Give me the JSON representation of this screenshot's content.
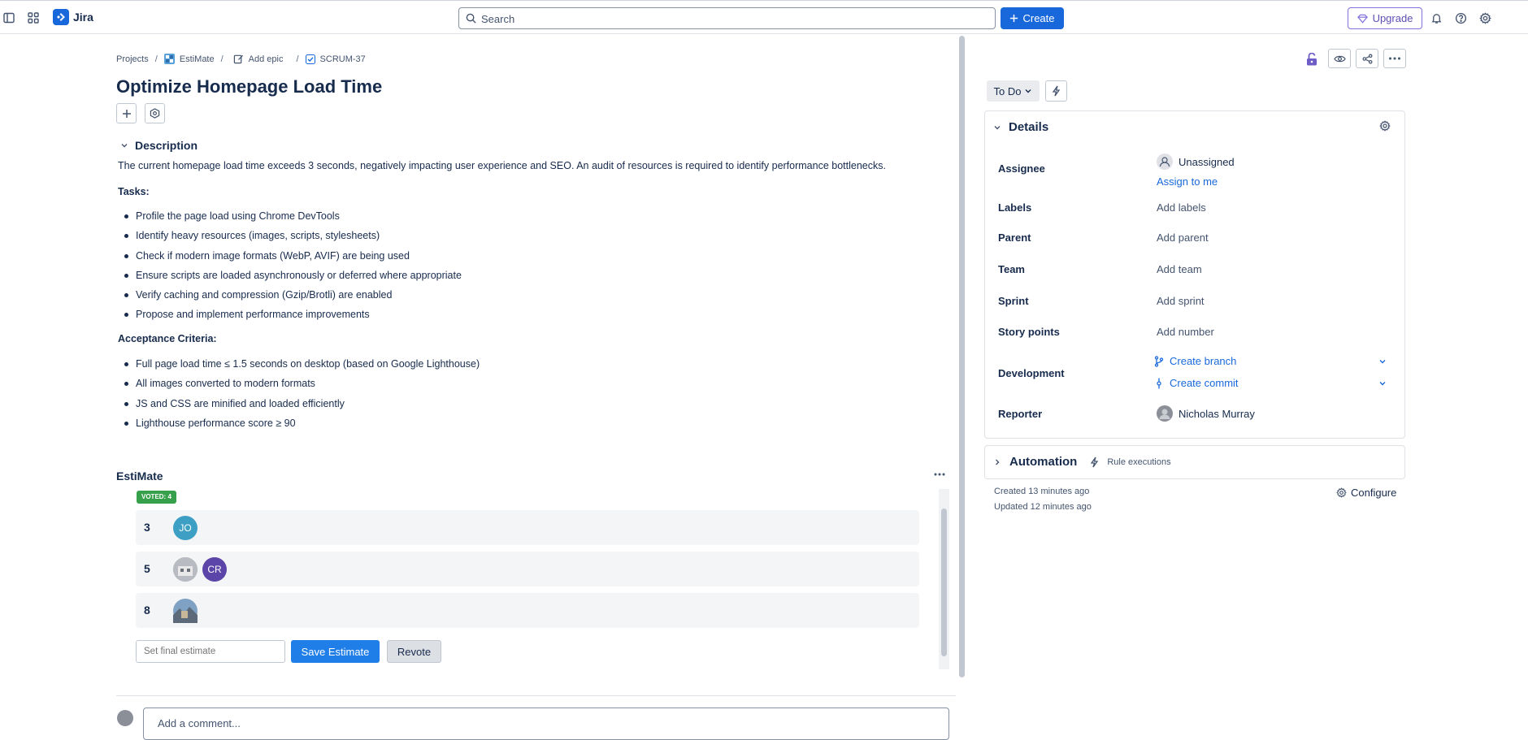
{
  "app": {
    "name": "Jira"
  },
  "topbar": {
    "search_placeholder": "Search",
    "create_label": "Create",
    "upgrade_label": "Upgrade",
    "icons": [
      "sidebar-toggle-icon",
      "app-switcher-icon",
      "bell-icon",
      "help-icon",
      "settings-icon"
    ]
  },
  "breadcrumb": {
    "projects": "Projects",
    "project": "EstiMate",
    "epic": "Add epic",
    "issue": "SCRUM-37"
  },
  "issue": {
    "title": "Optimize Homepage Load Time"
  },
  "description": {
    "heading": "Description",
    "intro": "The current homepage load time exceeds 3 seconds, negatively impacting user experience and SEO. An audit of resources is required to identify performance bottlenecks.",
    "tasks_heading": "Tasks:",
    "tasks": [
      "Profile the page load using Chrome DevTools",
      "Identify heavy resources (images, scripts, stylesheets)",
      "Check if modern image formats (WebP, AVIF) are being used",
      "Ensure scripts are loaded asynchronously or deferred where appropriate",
      "Verify caching and compression (Gzip/Brotli) are enabled",
      "Propose and implement performance improvements"
    ],
    "criteria_heading": "Acceptance Criteria:",
    "criteria": [
      "Full page load time ≤ 1.5 seconds on desktop (based on Google Lighthouse)",
      "All images converted to modern formats",
      "JS and CSS are minified and loaded efficiently",
      "Lighthouse performance score ≥ 90"
    ]
  },
  "estimate": {
    "title": "EstiMate",
    "voted_badge": "VOTED: 4",
    "rows": [
      {
        "value": "3",
        "voters": [
          "JO"
        ]
      },
      {
        "value": "5",
        "voters": [
          "",
          "CR"
        ]
      },
      {
        "value": "8",
        "voters": [
          ""
        ]
      }
    ],
    "avatar_colors": {
      "JO": "#3d9fc4",
      "CR": "#5b45a8"
    },
    "final_placeholder": "Set final estimate",
    "save_label": "Save Estimate",
    "revote_label": "Revote"
  },
  "comment": {
    "placeholder": "Add a comment..."
  },
  "status": {
    "label": "To Do"
  },
  "details": {
    "heading": "Details",
    "fields": {
      "assignee_label": "Assignee",
      "assignee_value": "Unassigned",
      "assign_to_me": "Assign to me",
      "labels_label": "Labels",
      "labels_value": "Add labels",
      "parent_label": "Parent",
      "parent_value": "Add parent",
      "team_label": "Team",
      "team_value": "Add team",
      "sprint_label": "Sprint",
      "sprint_value": "Add sprint",
      "story_points_label": "Story points",
      "story_points_value": "Add number",
      "development_label": "Development",
      "create_branch": "Create branch",
      "create_commit": "Create commit",
      "reporter_label": "Reporter",
      "reporter_value": "Nicholas Murray"
    }
  },
  "automation": {
    "heading": "Automation",
    "rule_executions": "Rule executions"
  },
  "meta": {
    "created": "Created 13 minutes ago",
    "updated": "Updated 12 minutes ago",
    "configure": "Configure"
  },
  "colors": {
    "brand": "#1868db",
    "upgrade": "#5e4db2",
    "voted": "#37a04a"
  }
}
